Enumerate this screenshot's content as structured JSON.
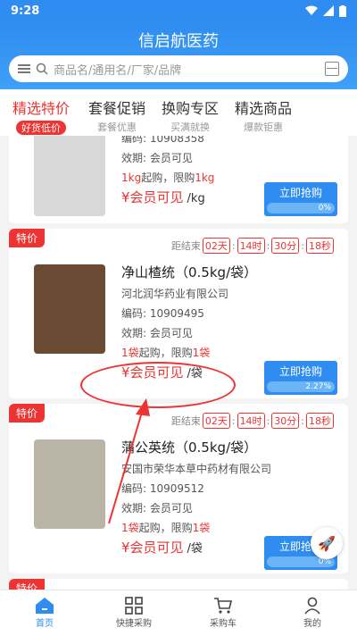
{
  "status": {
    "time": "9:28"
  },
  "app": {
    "title": "信启航医药"
  },
  "search": {
    "placeholder": "商品名/通用名/厂家/品牌"
  },
  "tabs": [
    {
      "label": "精选特价",
      "sub": "好货低价",
      "active": true
    },
    {
      "label": "套餐促销",
      "sub": "套餐优惠"
    },
    {
      "label": "换购专区",
      "sub": "买满就换"
    },
    {
      "label": "精选商品",
      "sub": "爆款钜惠"
    }
  ],
  "products": [
    {
      "code": "编码: 10908358",
      "validity": "效期: 会员可见",
      "limit_qty": "1kg",
      "limit_text": "起购，限购",
      "limit_max": "1kg",
      "price": "¥会员可见",
      "unit": "/kg",
      "buy_label": "立即抢购",
      "progress": "0%"
    },
    {
      "badge": "特价",
      "countdown_label": "距结束",
      "countdown": {
        "days": "02天",
        "hours": "14时",
        "minutes": "30分",
        "seconds": "18秒"
      },
      "name": "净山楂统（0.5kg/袋）",
      "company": "河北润华药业有限公司",
      "code": "编码: 10909495",
      "validity": "效期: 会员可见",
      "limit_qty": "1袋",
      "limit_text": "起购，限购",
      "limit_max": "1袋",
      "price": "¥会员可见",
      "unit": "/袋",
      "buy_label": "立即抢购",
      "progress": "2.27%"
    },
    {
      "badge": "特价",
      "countdown_label": "距结束",
      "countdown": {
        "days": "02天",
        "hours": "14时",
        "minutes": "30分",
        "seconds": "18秒"
      },
      "name": "蒲公英统（0.5kg/袋）",
      "company": "安国市荣华本草中药材有限公司",
      "code": "编码: 10909512",
      "validity": "效期: 会员可见",
      "limit_qty": "1袋",
      "limit_text": "起购，限购",
      "limit_max": "1袋",
      "price": "¥会员可见",
      "unit": "/袋",
      "buy_label": "立即抢购",
      "progress": "0%"
    },
    {
      "badge": "特价"
    }
  ],
  "nav": [
    {
      "label": "首页",
      "icon": "home-icon",
      "active": true
    },
    {
      "label": "快捷采购",
      "icon": "qr-grid-icon"
    },
    {
      "label": "采购车",
      "icon": "cart-icon"
    },
    {
      "label": "我的",
      "icon": "user-icon"
    }
  ],
  "colors": {
    "primary": "#2f8cf0",
    "accent": "#e33333"
  }
}
